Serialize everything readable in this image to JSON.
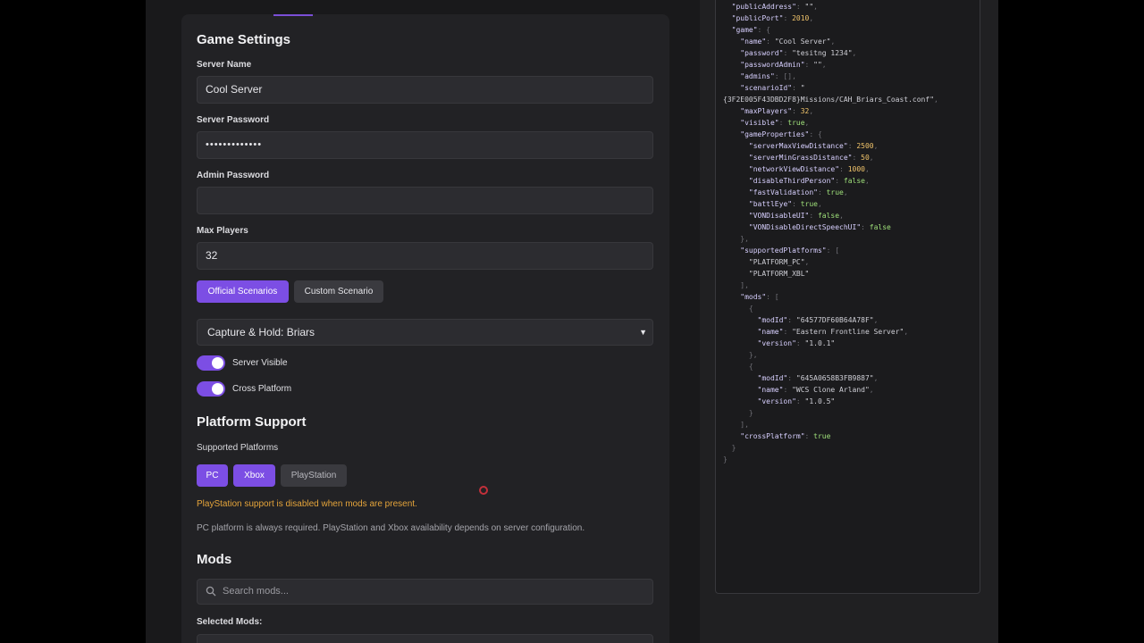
{
  "game_settings": {
    "title": "Game Settings",
    "server_name_label": "Server Name",
    "server_name_value": "Cool Server",
    "server_password_label": "Server Password",
    "server_password_value": "•••••••••••••",
    "admin_password_label": "Admin Password",
    "admin_password_value": "",
    "max_players_label": "Max Players",
    "max_players_value": "32",
    "scenario_tabs": [
      {
        "label": "Official Scenarios",
        "active": true
      },
      {
        "label": "Custom Scenario",
        "active": false
      }
    ],
    "scenario_selected": "Capture & Hold: Briars",
    "toggles": [
      {
        "label": "Server Visible",
        "on": true
      },
      {
        "label": "Cross Platform",
        "on": true
      }
    ]
  },
  "platform_support": {
    "title": "Platform Support",
    "supported_label": "Supported Platforms",
    "platforms": [
      {
        "label": "PC",
        "active": true
      },
      {
        "label": "Xbox",
        "active": true
      },
      {
        "label": "PlayStation",
        "active": false
      }
    ],
    "warning": "PlayStation support is disabled when mods are present.",
    "note": "PC platform is always required. PlayStation and Xbox availability depends on server configuration."
  },
  "mods": {
    "title": "Mods",
    "search_placeholder": "Search mods...",
    "selected_label": "Selected Mods:"
  },
  "colors": {
    "accent": "#7c4ee4",
    "warning": "#e5a43a"
  },
  "config_json": [
    [
      [
        "p",
        "  "
      ],
      [
        "k",
        "\"publicAddress\""
      ],
      [
        "p",
        ": "
      ],
      [
        "s",
        "\"\""
      ],
      [
        "p",
        ","
      ]
    ],
    [
      [
        "p",
        "  "
      ],
      [
        "k",
        "\"publicPort\""
      ],
      [
        "p",
        ": "
      ],
      [
        "n",
        "2010"
      ],
      [
        "p",
        ","
      ]
    ],
    [
      [
        "p",
        "  "
      ],
      [
        "k",
        "\"game\""
      ],
      [
        "p",
        ": {"
      ]
    ],
    [
      [
        "p",
        "    "
      ],
      [
        "k",
        "\"name\""
      ],
      [
        "p",
        ": "
      ],
      [
        "s",
        "\"Cool Server\""
      ],
      [
        "p",
        ","
      ]
    ],
    [
      [
        "p",
        "    "
      ],
      [
        "k",
        "\"password\""
      ],
      [
        "p",
        ": "
      ],
      [
        "s",
        "\"tesitng 1234\""
      ],
      [
        "p",
        ","
      ]
    ],
    [
      [
        "p",
        "    "
      ],
      [
        "k",
        "\"passwordAdmin\""
      ],
      [
        "p",
        ": "
      ],
      [
        "s",
        "\"\""
      ],
      [
        "p",
        ","
      ]
    ],
    [
      [
        "p",
        "    "
      ],
      [
        "k",
        "\"admins\""
      ],
      [
        "p",
        ": [],"
      ]
    ],
    [
      [
        "p",
        "    "
      ],
      [
        "k",
        "\"scenarioId\""
      ],
      [
        "p",
        ": "
      ],
      [
        "s",
        "\""
      ]
    ],
    [
      [
        "s",
        "{3F2E005F43DBD2F8}Missions/CAH_Briars_Coast.conf\""
      ],
      [
        "p",
        ","
      ]
    ],
    [
      [
        "p",
        "    "
      ],
      [
        "k",
        "\"maxPlayers\""
      ],
      [
        "p",
        ": "
      ],
      [
        "n",
        "32"
      ],
      [
        "p",
        ","
      ]
    ],
    [
      [
        "p",
        "    "
      ],
      [
        "k",
        "\"visible\""
      ],
      [
        "p",
        ": "
      ],
      [
        "b",
        "true"
      ],
      [
        "p",
        ","
      ]
    ],
    [
      [
        "p",
        "    "
      ],
      [
        "k",
        "\"gameProperties\""
      ],
      [
        "p",
        ": {"
      ]
    ],
    [
      [
        "p",
        "      "
      ],
      [
        "k",
        "\"serverMaxViewDistance\""
      ],
      [
        "p",
        ": "
      ],
      [
        "n",
        "2500"
      ],
      [
        "p",
        ","
      ]
    ],
    [
      [
        "p",
        "      "
      ],
      [
        "k",
        "\"serverMinGrassDistance\""
      ],
      [
        "p",
        ": "
      ],
      [
        "n",
        "50"
      ],
      [
        "p",
        ","
      ]
    ],
    [
      [
        "p",
        "      "
      ],
      [
        "k",
        "\"networkViewDistance\""
      ],
      [
        "p",
        ": "
      ],
      [
        "n",
        "1000"
      ],
      [
        "p",
        ","
      ]
    ],
    [
      [
        "p",
        "      "
      ],
      [
        "k",
        "\"disableThirdPerson\""
      ],
      [
        "p",
        ": "
      ],
      [
        "b",
        "false"
      ],
      [
        "p",
        ","
      ]
    ],
    [
      [
        "p",
        "      "
      ],
      [
        "k",
        "\"fastValidation\""
      ],
      [
        "p",
        ": "
      ],
      [
        "b",
        "true"
      ],
      [
        "p",
        ","
      ]
    ],
    [
      [
        "p",
        "      "
      ],
      [
        "k",
        "\"battlEye\""
      ],
      [
        "p",
        ": "
      ],
      [
        "b",
        "true"
      ],
      [
        "p",
        ","
      ]
    ],
    [
      [
        "p",
        "      "
      ],
      [
        "k",
        "\"VONDisableUI\""
      ],
      [
        "p",
        ": "
      ],
      [
        "b",
        "false"
      ],
      [
        "p",
        ","
      ]
    ],
    [
      [
        "p",
        "      "
      ],
      [
        "k",
        "\"VONDisableDirectSpeechUI\""
      ],
      [
        "p",
        ": "
      ],
      [
        "b",
        "false"
      ]
    ],
    [
      [
        "p",
        "    },"
      ]
    ],
    [
      [
        "p",
        "    "
      ],
      [
        "k",
        "\"supportedPlatforms\""
      ],
      [
        "p",
        ": ["
      ]
    ],
    [
      [
        "p",
        "      "
      ],
      [
        "s",
        "\"PLATFORM_PC\""
      ],
      [
        "p",
        ","
      ]
    ],
    [
      [
        "p",
        "      "
      ],
      [
        "s",
        "\"PLATFORM_XBL\""
      ]
    ],
    [
      [
        "p",
        "    ],"
      ]
    ],
    [
      [
        "p",
        "    "
      ],
      [
        "k",
        "\"mods\""
      ],
      [
        "p",
        ": ["
      ]
    ],
    [
      [
        "p",
        "      {"
      ]
    ],
    [
      [
        "p",
        "        "
      ],
      [
        "k",
        "\"modId\""
      ],
      [
        "p",
        ": "
      ],
      [
        "s",
        "\"64577DF60B64A78F\""
      ],
      [
        "p",
        ","
      ]
    ],
    [
      [
        "p",
        "        "
      ],
      [
        "k",
        "\"name\""
      ],
      [
        "p",
        ": "
      ],
      [
        "s",
        "\"Eastern Frontline Server\""
      ],
      [
        "p",
        ","
      ]
    ],
    [
      [
        "p",
        "        "
      ],
      [
        "k",
        "\"version\""
      ],
      [
        "p",
        ": "
      ],
      [
        "s",
        "\"1.0.1\""
      ]
    ],
    [
      [
        "p",
        "      },"
      ]
    ],
    [
      [
        "p",
        "      {"
      ]
    ],
    [
      [
        "p",
        "        "
      ],
      [
        "k",
        "\"modId\""
      ],
      [
        "p",
        ": "
      ],
      [
        "s",
        "\"645A0658B3FB9887\""
      ],
      [
        "p",
        ","
      ]
    ],
    [
      [
        "p",
        "        "
      ],
      [
        "k",
        "\"name\""
      ],
      [
        "p",
        ": "
      ],
      [
        "s",
        "\"WCS Clone Arland\""
      ],
      [
        "p",
        ","
      ]
    ],
    [
      [
        "p",
        "        "
      ],
      [
        "k",
        "\"version\""
      ],
      [
        "p",
        ": "
      ],
      [
        "s",
        "\"1.0.5\""
      ]
    ],
    [
      [
        "p",
        "      }"
      ]
    ],
    [
      [
        "p",
        "    ],"
      ]
    ],
    [
      [
        "p",
        "    "
      ],
      [
        "k",
        "\"crossPlatform\""
      ],
      [
        "p",
        ": "
      ],
      [
        "b",
        "true"
      ]
    ],
    [
      [
        "p",
        "  }"
      ]
    ],
    [
      [
        "p",
        "}"
      ]
    ]
  ]
}
